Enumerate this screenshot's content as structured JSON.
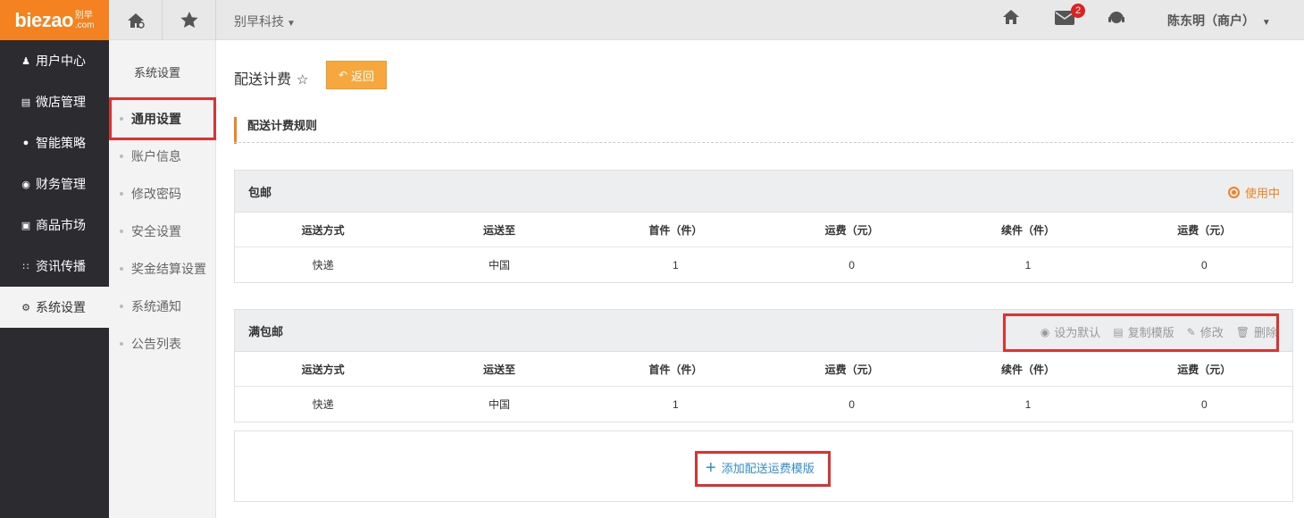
{
  "logo": {
    "brand": "biezao",
    "sub_top": "别早",
    "sub_bottom": ".com"
  },
  "nav": {
    "items": [
      {
        "icon": "user-icon",
        "label": "用户中心"
      },
      {
        "icon": "shop-icon",
        "label": "微店管理"
      },
      {
        "icon": "strategy-icon",
        "label": "智能策略"
      },
      {
        "icon": "money-bag-icon",
        "label": "财务管理"
      },
      {
        "icon": "market-icon",
        "label": "商品市场"
      },
      {
        "icon": "grid-icon",
        "label": "资讯传播"
      },
      {
        "icon": "gear-icon",
        "label": "系统设置"
      }
    ],
    "active_index": 6
  },
  "topbar": {
    "company": "别早科技",
    "mail_count": "2",
    "user": "陈东明（商户）"
  },
  "subnav": {
    "title": "系统设置",
    "items": [
      "通用设置",
      "账户信息",
      "修改密码",
      "安全设置",
      "奖金结算设置",
      "系统通知",
      "公告列表"
    ],
    "active_index": 0
  },
  "page": {
    "title": "配送计费",
    "back_label": "返回",
    "section_title": "配送计费规则"
  },
  "columns": [
    "运送方式",
    "运送至",
    "首件（件）",
    "运费（元）",
    "续件（件）",
    "运费（元）"
  ],
  "templates": [
    {
      "name": "包邮",
      "status": "使用中",
      "rows": [
        [
          "快递",
          "中国",
          "1",
          "0",
          "1",
          "0"
        ]
      ]
    },
    {
      "name": "满包邮",
      "actions": [
        "设为默认",
        "复制模版",
        "修改",
        "删除"
      ],
      "rows": [
        [
          "快递",
          "中国",
          "1",
          "0",
          "1",
          "0"
        ]
      ]
    }
  ],
  "add_template_label": "添加配送运费模版",
  "colors": {
    "accent": "#f58220",
    "sidebar": "#2b2b30",
    "link": "#2f8fd6",
    "highlight": "#e03030"
  }
}
